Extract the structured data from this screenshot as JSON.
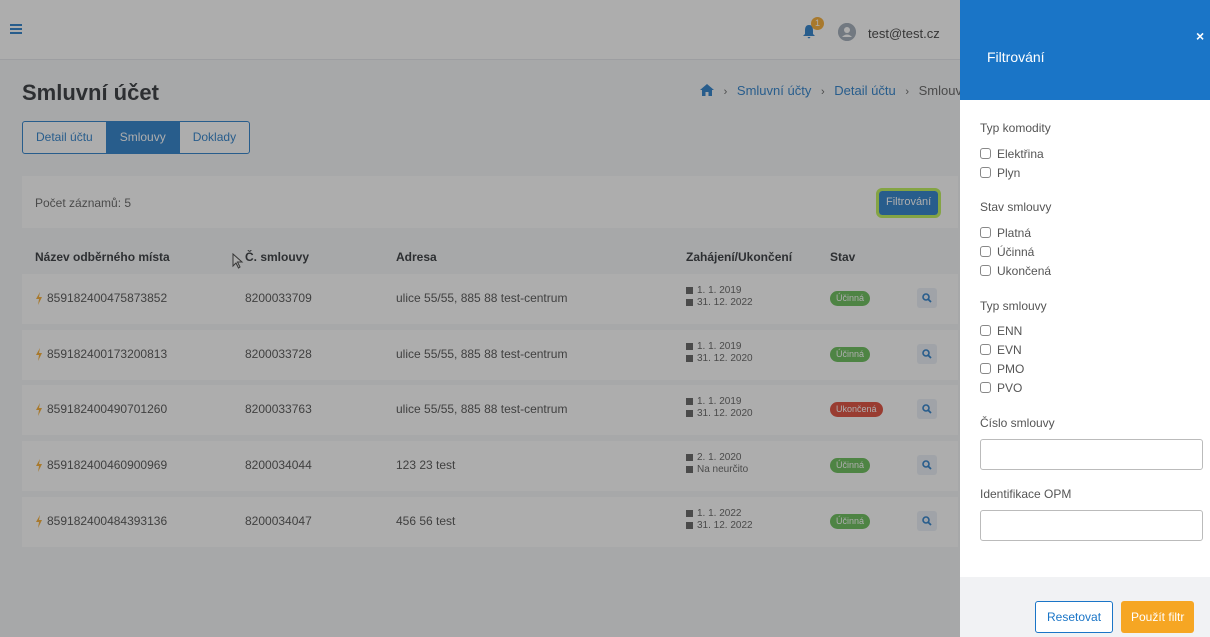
{
  "topbar": {
    "notification_count": "1",
    "user_email": "test@test.cz"
  },
  "page": {
    "title": "Smluvní účet"
  },
  "breadcrumb": {
    "item1": "Smluvní účty",
    "item2": "Detail účtu",
    "current": "Smlouvy"
  },
  "tabs": [
    {
      "label": "Detail účtu",
      "active": false
    },
    {
      "label": "Smlouvy",
      "active": true
    },
    {
      "label": "Doklady",
      "active": false
    }
  ],
  "records": {
    "count_label": "Počet záznamů: 5",
    "filter_button": "Filtrování"
  },
  "table": {
    "headers": {
      "place": "Název odběrného místa",
      "contract": "Č. smlouvy",
      "address": "Adresa",
      "dates": "Zahájení/Ukončení",
      "status": "Stav"
    },
    "rows": [
      {
        "place": "859182400475873852",
        "contract": "8200033709",
        "address": "ulice 55/55, 885 88 test-centrum",
        "start": "1. 1. 2019",
        "end": "31. 12. 2022",
        "status": "Účinná"
      },
      {
        "place": "859182400173200813",
        "contract": "8200033728",
        "address": "ulice 55/55, 885 88 test-centrum",
        "start": "1. 1. 2019",
        "end": "31. 12. 2020",
        "status": "Účinná"
      },
      {
        "place": "859182400490701260",
        "contract": "8200033763",
        "address": "ulice 55/55, 885 88 test-centrum",
        "start": "1. 1. 2019",
        "end": "31. 12. 2020",
        "status": "Ukončená"
      },
      {
        "place": "859182400460900969",
        "contract": "8200034044",
        "address": "123 23 test",
        "start": "2. 1. 2020",
        "end": "Na neurčito",
        "status": "Účinná"
      },
      {
        "place": "859182400484393136",
        "contract": "8200034047",
        "address": "456 56 test",
        "start": "1. 1. 2022",
        "end": "31. 12. 2022",
        "status": "Účinná"
      }
    ]
  },
  "panel": {
    "title": "Filtrování",
    "close": "×",
    "commodity_label": "Typ komodity",
    "commodity": [
      "Elektřina",
      "Plyn"
    ],
    "state_label": "Stav smlouvy",
    "state": [
      "Platná",
      "Účinná",
      "Ukončená"
    ],
    "type_label": "Typ smlouvy",
    "type": [
      "ENN",
      "EVN",
      "PMO",
      "PVO"
    ],
    "contract_number_label": "Číslo smlouvy",
    "contract_number_value": "",
    "opm_label": "Identifikace OPM",
    "opm_value": "",
    "reset_button": "Resetovat",
    "apply_button": "Použít filtr"
  },
  "colors": {
    "primary": "#1a75c7",
    "accent": "#f6a623",
    "status_active": "#5cb84a",
    "status_ended": "#dc3d2a",
    "highlight": "#b8f04a"
  }
}
